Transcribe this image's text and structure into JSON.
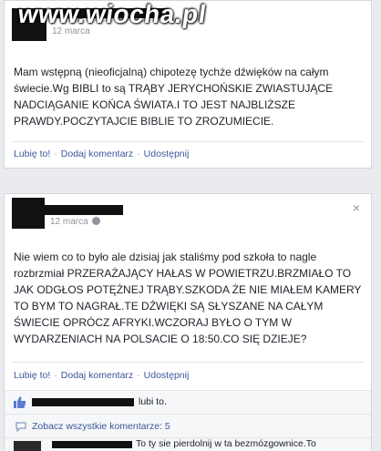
{
  "watermark": "www.wiocha.pl",
  "post1": {
    "date": "12 marca",
    "text_lines": [
      "Mam wstępną (nieoficjalną) chipotezę tychże dźwięków na całym",
      "świecie.Wg BIBLI to są TRĄBY JERYCHOŃSKIE ZWIASTUJĄCE",
      "NADCIĄGANIE KOŃCA ŚWIATA.I TO JEST NAJBLIŻSZE",
      "PRAWDY.POCZYTAJCIE BIBLIE TO ZROZUMIECIE."
    ],
    "actions": {
      "like": "Lubię to!",
      "comment": "Dodaj komentarz",
      "share": "Udostępnij"
    }
  },
  "post2": {
    "date": "12 marca",
    "close": "×",
    "text_lines": [
      "Nie wiem co to było ale dzisiaj jak staliśmy pod szkoła to nagle",
      "rozbrzmiał PRZERAŻAJĄCY HAŁAS W POWIETRZU.BRZMIAŁO TO",
      "JAK ODGŁOS POTĘŻNEJ TRĄBY.SZKODA ŻE NIE MIAŁEM KAMERY",
      "TO BYM TO NAGRAŁ.TE DŹWIĘKI SĄ SŁYSZANE NA CAŁYM",
      "ŚWIECIE OPRÓCZ AFRYKI.WCZORAJ BYŁO O TYM W",
      "WYDARZENIACH NA POLSACIE O 18:50.CO SIĘ DZIEJE?"
    ],
    "actions": {
      "like": "Lubię to!",
      "comment": "Dodaj komentarz",
      "share": "Udostępnij"
    },
    "likes_text": "lubi to.",
    "comments_link": "Zobacz wszystkie komentarze: 5",
    "first_comment": "To ty sie pierdolnij w ta bezmózgownice.To"
  },
  "colors": {
    "link": "#385898",
    "text": "#1d2129",
    "meta": "#90949c",
    "background": "#e9ebee"
  },
  "icons": [
    "globe-icon",
    "thumbs-up-icon",
    "comment-icon",
    "close-icon"
  ]
}
